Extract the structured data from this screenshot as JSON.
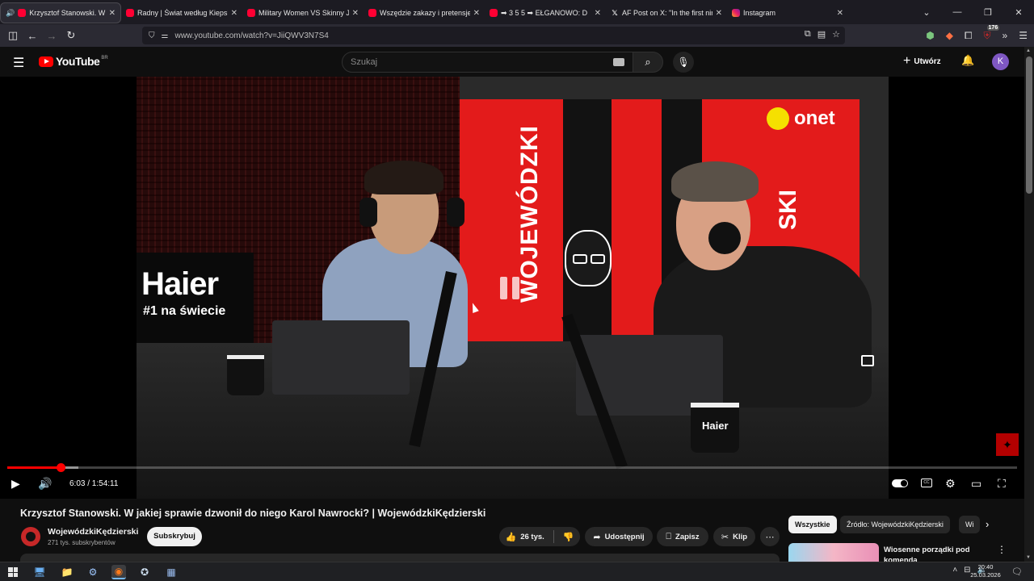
{
  "browser": {
    "tabs": [
      {
        "title": "Krzysztof Stanowski. W jaki",
        "icon": "youtube-icon",
        "audio": true,
        "active": true
      },
      {
        "title": "Radny | Świat według Kiepskich",
        "icon": "youtube-icon",
        "audio": false,
        "active": false
      },
      {
        "title": "Military Women VS Skinny Joes",
        "icon": "youtube-icon",
        "audio": false,
        "active": false
      },
      {
        "title": "Wszędzie zakazy i pretensje! Lu",
        "icon": "youtube-icon",
        "audio": false,
        "active": false
      },
      {
        "title": "➡ 3 5 5 ➡ EŁGANOWO: D",
        "icon": "youtube-icon",
        "audio": false,
        "active": false
      },
      {
        "title": "AF Post on X: \"In the first nine m",
        "icon": "x-icon",
        "audio": false,
        "active": false
      },
      {
        "title": "Instagram",
        "icon": "instagram-icon",
        "audio": false,
        "active": false
      }
    ],
    "url": "www.youtube.com/watch?v=JiiQWV3N7S4",
    "extension_badge": "176"
  },
  "youtube": {
    "logo_text": "YouTube",
    "country_code": "BR",
    "search_placeholder": "Szukaj",
    "create_label": "Utwórz",
    "avatar_letter": "K"
  },
  "video_frame": {
    "sponsor_brand": "Haier",
    "sponsor_tagline": "#1 na świecie",
    "studio_brand": "onet",
    "show_name_left": "WOJEWÓDZKI",
    "show_name_right": "SKI",
    "mug_label": "Haier"
  },
  "player": {
    "current_time": "6:03",
    "duration": "1:54:11",
    "time_display": "6:03 / 1:54:11",
    "progress_fraction": 0.053,
    "buffered_fraction": 0.07,
    "state": "paused",
    "autoplay": true
  },
  "video": {
    "title": "Krzysztof Stanowski. W jakiej sprawie dzwonił do niego Karol Nawrocki? | WojewódzkiKędzierski",
    "channel": "WojewódzkiKędzierski",
    "subscribers": "271 tys. subskrybentów",
    "subscribe_label": "Subskrybuj",
    "likes": "26 tys.",
    "share_label": "Udostępnij",
    "save_label": "Zapisz",
    "clip_label": "Klip"
  },
  "sidebar": {
    "chips": [
      {
        "label": "Wszystkie",
        "selected": true
      },
      {
        "label": "Źródło: WojewódzkiKędzierski",
        "selected": false
      },
      {
        "label": "Wi",
        "selected": false
      }
    ],
    "recommendation_title": "Wiosenne porządki pod komendą"
  },
  "taskbar": {
    "time": "20:40",
    "date": "25.03.2026"
  },
  "colors": {
    "accent_red": "#ff0000",
    "youtube_bg": "#0f0f0f",
    "avatar_bg": "#7e57c2",
    "studio_red": "#e31b1b"
  }
}
